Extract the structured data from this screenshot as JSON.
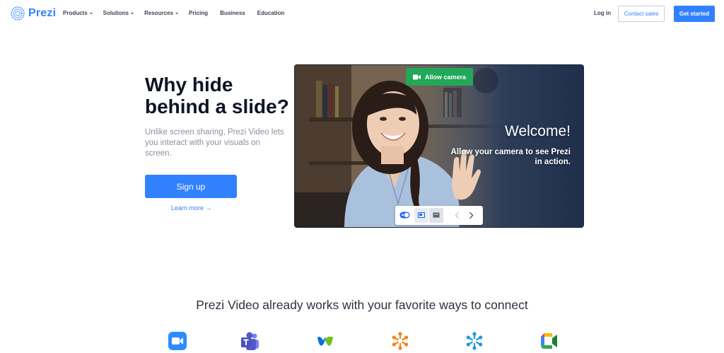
{
  "brand": {
    "name": "Prezi",
    "color": "#3181ff",
    "logo_icon": "prezi-logo-icon"
  },
  "nav": {
    "menu": [
      {
        "label": "Products",
        "dropdown": true
      },
      {
        "label": "Solutions",
        "dropdown": true
      },
      {
        "label": "Resources",
        "dropdown": true
      },
      {
        "label": "Pricing",
        "dropdown": false
      },
      {
        "label": "Business",
        "dropdown": false
      },
      {
        "label": "Education",
        "dropdown": false
      }
    ],
    "login": "Log in",
    "contact_sales": "Contact sales",
    "get_started": "Get started"
  },
  "hero": {
    "headline_line1": "Why hide",
    "headline_line2": "behind a slide?",
    "subtext": "Unlike screen sharing, Prezi Video lets you interact with your visuals on screen.",
    "signup": "Sign up",
    "learn_more": "Learn more →"
  },
  "video": {
    "allow_camera": "Allow camera",
    "allow_camera_icon": "video-camera-icon",
    "welcome": "Welcome!",
    "welcome_sub": "Allow your camera to see Prezi in action.",
    "controls": [
      "camera-toggle-icon",
      "layout-picture-icon",
      "layout-slide-icon",
      "chevron-left-icon",
      "chevron-right-icon"
    ],
    "colors": {
      "allow_camera_bg": "#23a758"
    }
  },
  "integrations": {
    "heading": "Prezi Video already works with your favorite ways to connect",
    "icons": [
      "zoom-icon",
      "microsoft-teams-icon",
      "webex-icon",
      "orange-asterisk-icon",
      "blue-asterisk-icon",
      "google-meet-icon"
    ]
  }
}
